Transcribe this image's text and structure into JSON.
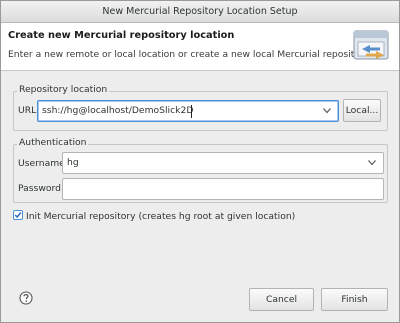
{
  "window": {
    "title": "New Mercurial Repository Location Setup"
  },
  "header": {
    "title": "Create new Mercurial repository location",
    "description": "Enter a new remote or local location or create a new local Mercurial repository.",
    "icon": "repository-location-icon"
  },
  "repository_location": {
    "legend": "Repository location",
    "url_label": "URL",
    "url_value": "ssh://hg@localhost/DemoSlick2D",
    "local_button": "Local..."
  },
  "authentication": {
    "legend": "Authentication",
    "username_label": "Username",
    "username_value": "hg",
    "password_label": "Password",
    "password_value": ""
  },
  "init_checkbox": {
    "label": "Init Mercurial repository (creates hg root at given location)",
    "checked": true
  },
  "footer": {
    "help_icon": "help-icon",
    "cancel_label": "Cancel",
    "finish_label": "Finish"
  },
  "colors": {
    "focus_accent": "#4a90d9",
    "header_bg": "#ffffff",
    "window_bg": "#ededed"
  }
}
